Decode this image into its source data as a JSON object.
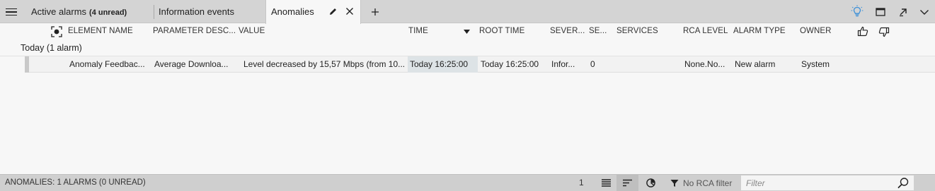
{
  "tabs": {
    "active_alarms_label": "Active alarms",
    "active_alarms_unread": "(4 unread)",
    "information_events_label": "Information events",
    "anomalies_label": "Anomalies"
  },
  "columns": {
    "element_name": "ELEMENT NAME",
    "parameter_desc": "PARAMETER DESC...",
    "value": "VALUE",
    "time": "TIME",
    "root_time": "ROOT TIME",
    "severity": "SEVER...",
    "se": "SE...",
    "services": "SERVICES",
    "rca_level": "RCA LEVEL",
    "alarm_type": "ALARM TYPE",
    "owner": "OWNER"
  },
  "group": {
    "label": "Today (1 alarm)"
  },
  "rows": [
    {
      "element_name": "Anomaly Feedbac...",
      "parameter_desc": "Average Downloa...",
      "value": "Level decreased by 15,57 Mbps (from 10...",
      "time": "Today 16:25:00",
      "root_time": "Today 16:25:00",
      "severity": "Infor...",
      "se": "0",
      "services": "",
      "rca_level": "None.No...",
      "alarm_type": "New alarm",
      "owner": "System"
    }
  ],
  "statusbar": {
    "summary": "ANOMALIES: 1 ALARMS (0 UNREAD)",
    "count": "1",
    "rca_filter": "No RCA filter",
    "filter_placeholder": "Filter"
  },
  "icons": {
    "menu": "hamburger-icon",
    "edit": "pencil-icon",
    "close": "close-icon",
    "add": "plus-icon",
    "lightbulb": "lightbulb-icon",
    "window": "window-icon",
    "popout": "popout-arrow-icon",
    "chevron": "chevron-down-icon",
    "focus": "focus-target-icon",
    "sort": "sort-desc-icon",
    "thumbs_up": "thumbs-up-icon",
    "thumbs_down": "thumbs-down-icon",
    "list_view": "list-view-icon",
    "sort_lines": "sort-lines-icon",
    "pie": "pie-chart-icon",
    "filter": "funnel-icon",
    "search": "search-icon"
  },
  "colors": {
    "accent": "#3a8fd8",
    "tabbar_bg": "#d4d4d4",
    "statusbar_bg": "#cfcfcf",
    "sorted_cell": "#dde3e6"
  }
}
